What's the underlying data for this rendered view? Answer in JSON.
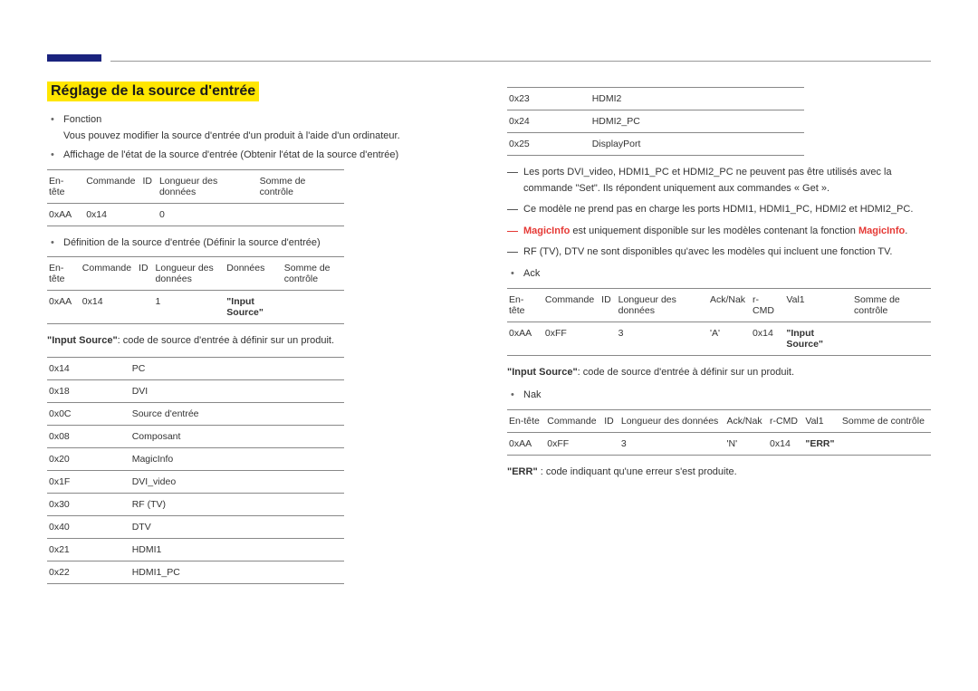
{
  "title": "Réglage de la source d'entrée",
  "left": {
    "bullets": [
      {
        "label": "Fonction",
        "sub": "Vous pouvez modifier la source d'entrée d'un produit à l'aide d'un ordinateur."
      },
      {
        "label": "Affichage de l'état de la source d'entrée (Obtenir l'état de la source d'entrée)"
      }
    ],
    "table1": {
      "headers": [
        "En-tête",
        "Commande",
        "ID",
        "Longueur des données",
        "Somme de contrôle"
      ],
      "row": [
        "0xAA",
        "0x14",
        "",
        "0",
        ""
      ]
    },
    "bullet3": "Définition de la source d'entrée (Définir la source d'entrée)",
    "table2": {
      "headers": [
        "En-tête",
        "Commande",
        "ID",
        "Longueur des données",
        "Données",
        "Somme de contrôle"
      ],
      "row": [
        "0xAA",
        "0x14",
        "",
        "1",
        "\"Input Source\"",
        ""
      ]
    },
    "note1_pre": "\"Input Source\"",
    "note1_rest": ": code de source d'entrée à définir sur un produit.",
    "sources": [
      [
        "0x14",
        "PC"
      ],
      [
        "0x18",
        "DVI"
      ],
      [
        "0x0C",
        "Source d'entrée"
      ],
      [
        "0x08",
        "Composant"
      ],
      [
        "0x20",
        "MagicInfo"
      ],
      [
        "0x1F",
        "DVI_video"
      ],
      [
        "0x30",
        "RF (TV)"
      ],
      [
        "0x40",
        "DTV"
      ],
      [
        "0x21",
        "HDMI1"
      ],
      [
        "0x22",
        "HDMI1_PC"
      ]
    ]
  },
  "right": {
    "sources": [
      [
        "0x23",
        "HDMI2"
      ],
      [
        "0x24",
        "HDMI2_PC"
      ],
      [
        "0x25",
        "DisplayPort"
      ]
    ],
    "dashes": [
      "Les ports DVI_video, HDMI1_PC et HDMI2_PC ne peuvent pas être utilisés avec la commande \"Set\". Ils répondent uniquement aux commandes « Get ».",
      "Ce modèle ne prend pas en charge les ports HDMI1, HDMI1_PC, HDMI2 et HDMI2_PC.",
      "",
      "RF (TV), DTV ne sont disponibles qu'avec les modèles qui incluent une fonction TV."
    ],
    "magicinfo_pre": "MagicInfo",
    "magicinfo_mid": " est uniquement disponible sur les modèles contenant la fonction ",
    "magicinfo_post": "MagicInfo",
    "magicinfo_end": ".",
    "ack_label": "Ack",
    "ack_table": {
      "headers": [
        "En-tête",
        "Commande",
        "ID",
        "Longueur des données",
        "Ack/Nak",
        "r-CMD",
        "Val1",
        "Somme de contrôle"
      ],
      "row": [
        "0xAA",
        "0xFF",
        "",
        "3",
        "'A'",
        "0x14",
        "\"Input Source\"",
        ""
      ]
    },
    "note2_pre": "\"Input Source\"",
    "note2_rest": ": code de source d'entrée à définir sur un produit.",
    "nak_label": "Nak",
    "nak_table": {
      "headers": [
        "En-tête",
        "Commande",
        "ID",
        "Longueur des données",
        "Ack/Nak",
        "r-CMD",
        "Val1",
        "Somme de contrôle"
      ],
      "row": [
        "0xAA",
        "0xFF",
        "",
        "3",
        "'N'",
        "0x14",
        "\"ERR\"",
        ""
      ]
    },
    "err_pre": "\"ERR\"",
    "err_rest": " : code indiquant qu'une erreur s'est produite."
  }
}
